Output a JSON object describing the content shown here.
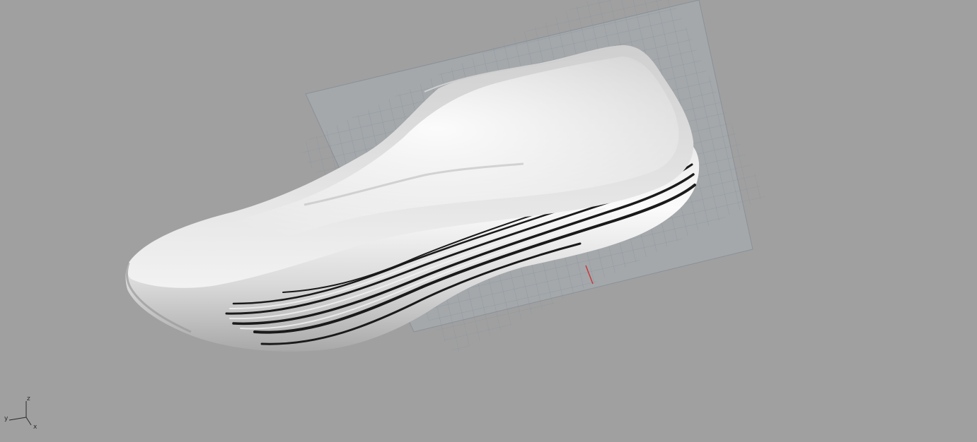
{
  "viewport": {
    "background_color": "#a0a0a0",
    "model": "shoe-last",
    "render_mode": "shaded",
    "construction_grid": {
      "visible": true,
      "line_color": "#8c969e",
      "origin_axis_color": "#c83a3a"
    },
    "axis_gizmo": {
      "z_label": "z",
      "y_label": "y",
      "x_label": "x"
    }
  }
}
